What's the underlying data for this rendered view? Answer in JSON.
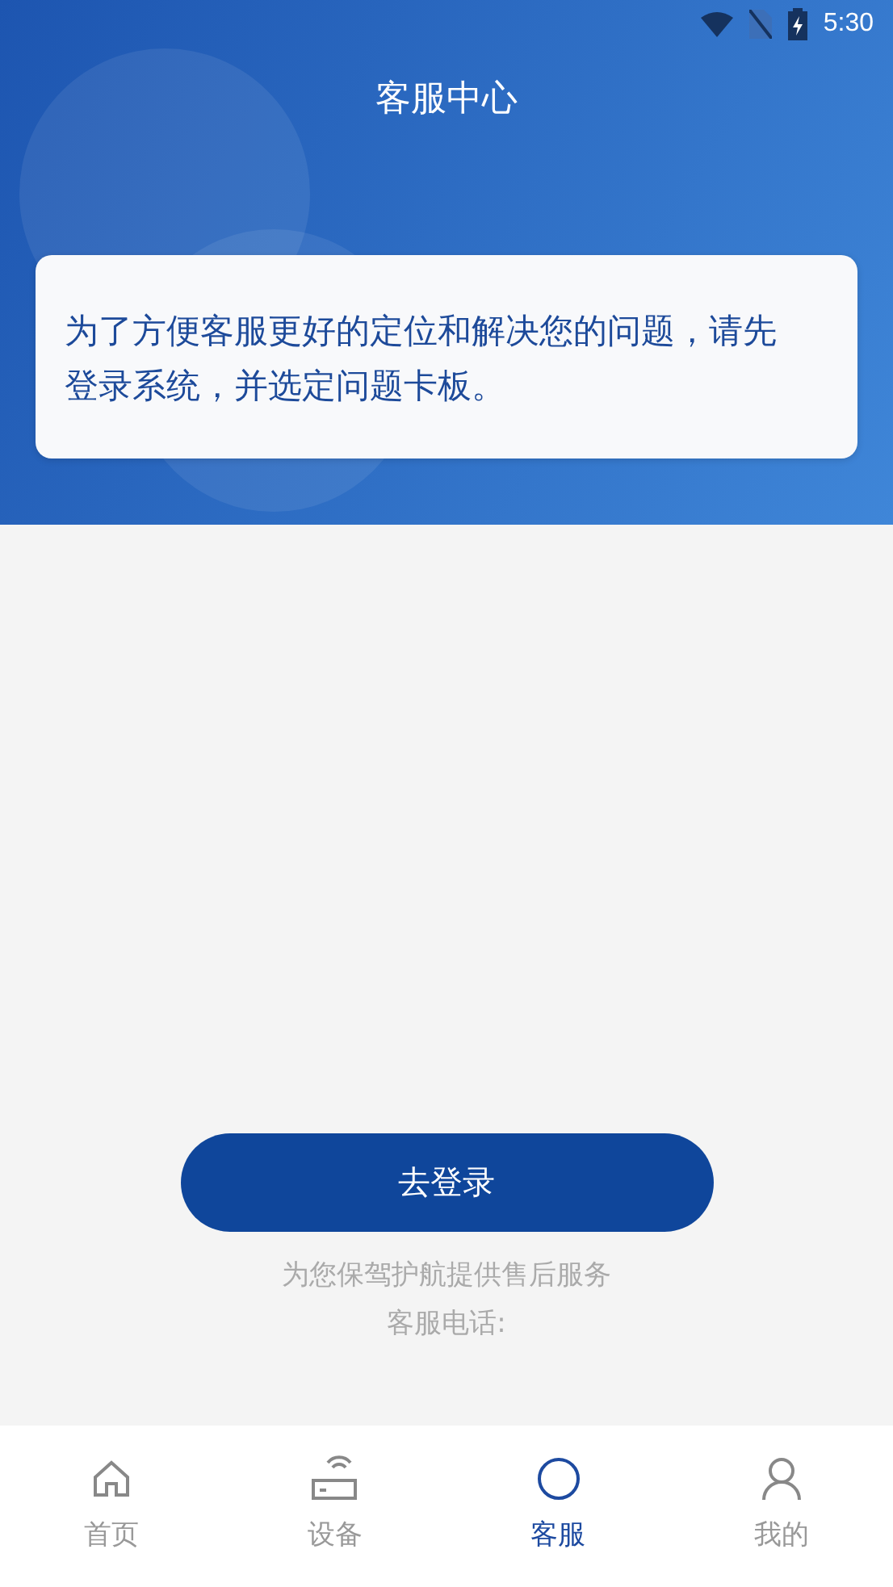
{
  "status_bar": {
    "time": "5:30"
  },
  "header": {
    "title": "客服中心"
  },
  "notice": {
    "text": "为了方便客服更好的定位和解决您的问题，请先登录系统，并选定问题卡板。"
  },
  "login_button": {
    "label": "去登录"
  },
  "footer_lines": [
    "为您保驾护航提供售后服务",
    "客服电话:"
  ],
  "tabs": [
    {
      "label": "首页",
      "selected": false
    },
    {
      "label": "设备",
      "selected": false
    },
    {
      "label": "客服",
      "selected": true
    },
    {
      "label": "我的",
      "selected": false
    }
  ]
}
